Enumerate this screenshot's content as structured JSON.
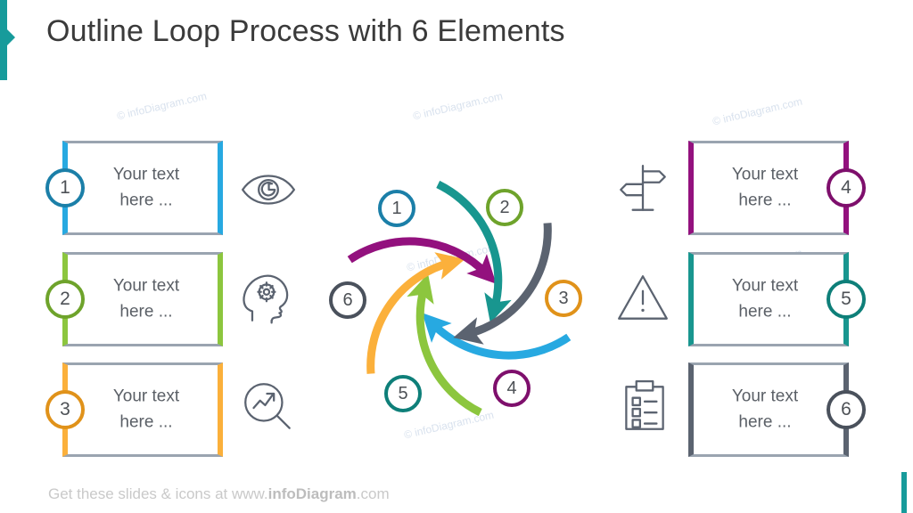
{
  "slide": {
    "title": "Outline Loop Process with 6 Elements",
    "footer_prefix": "Get these slides & icons at www.",
    "footer_brand": "infoDiagram",
    "footer_suffix": ".com",
    "accent_color": "#179b9b",
    "watermark_text": "© infoDiagram.com"
  },
  "boxes": [
    {
      "number": "1",
      "line1": "Your text",
      "line2": "here ...",
      "color": "#27A9E1",
      "ring_color": "#1B7FA8",
      "icon": "eye-icon",
      "side": "left"
    },
    {
      "number": "2",
      "line1": "Your text",
      "line2": "here ...",
      "color": "#8CC63E",
      "ring_color": "#6EA32B",
      "icon": "head-gear-icon",
      "side": "left"
    },
    {
      "number": "3",
      "line1": "Your text",
      "line2": "here ...",
      "color": "#FBB03B",
      "ring_color": "#E0921A",
      "icon": "growth-search-icon",
      "side": "left"
    },
    {
      "number": "4",
      "line1": "Your text",
      "line2": "here ...",
      "color": "#93117E",
      "ring_color": "#7E0F6C",
      "icon": "signpost-icon",
      "side": "right"
    },
    {
      "number": "5",
      "line1": "Your text",
      "line2": "here ...",
      "color": "#18968F",
      "ring_color": "#0E7F79",
      "icon": "warning-icon",
      "side": "right"
    },
    {
      "number": "6",
      "line1": "Your text",
      "line2": "here ...",
      "color": "#5B6370",
      "ring_color": "#4A515C",
      "icon": "clipboard-icon",
      "side": "right"
    }
  ],
  "loop": {
    "direction": "clockwise",
    "steps": [
      {
        "number": "1",
        "color": "#27A9E1",
        "ring_color": "#1B7FA8",
        "position": "top-left"
      },
      {
        "number": "2",
        "color": "#8CC63E",
        "ring_color": "#6EA32B",
        "position": "top-right"
      },
      {
        "number": "3",
        "color": "#FBB03B",
        "ring_color": "#E0921A",
        "position": "right"
      },
      {
        "number": "4",
        "color": "#93117E",
        "ring_color": "#7E0F6C",
        "position": "bottom-right"
      },
      {
        "number": "5",
        "color": "#18968F",
        "ring_color": "#0E7F79",
        "position": "bottom-left"
      },
      {
        "number": "6",
        "color": "#5B6370",
        "ring_color": "#4A515C",
        "position": "left"
      }
    ]
  }
}
